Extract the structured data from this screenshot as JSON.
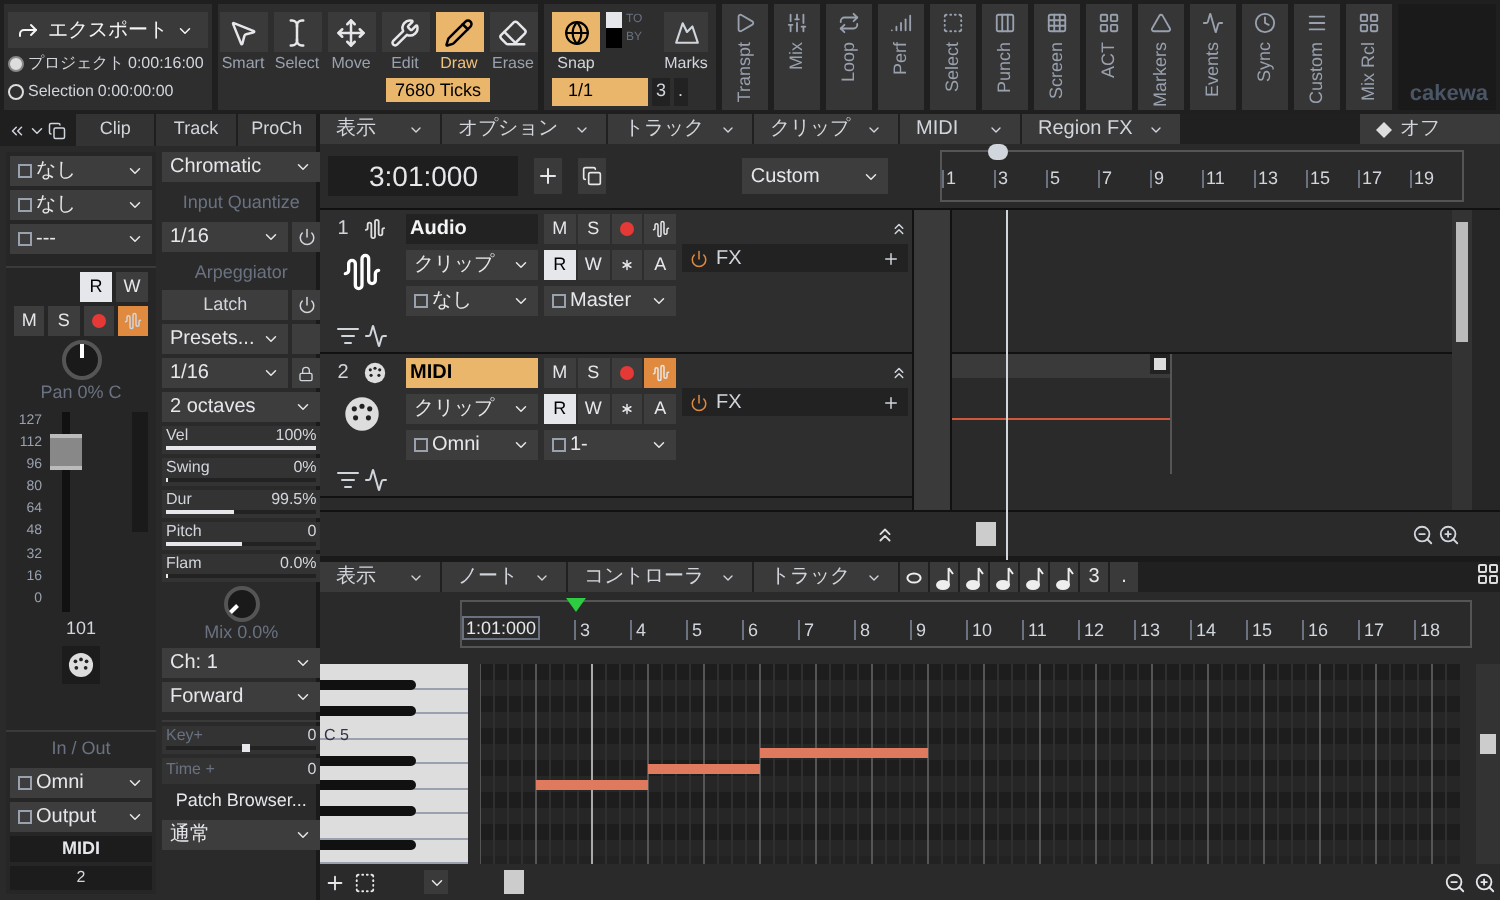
{
  "export": {
    "label": "エクスポート",
    "ranges": [
      {
        "label": "プロジェクト",
        "value": "0:00:16:00",
        "selected": true
      },
      {
        "label": "Selection",
        "value": "0:00:00:00",
        "selected": false
      }
    ]
  },
  "tools": [
    {
      "kind": "smart",
      "label": "Smart",
      "selected": false
    },
    {
      "kind": "select",
      "label": "Select",
      "selected": false
    },
    {
      "kind": "move",
      "label": "Move",
      "selected": false
    },
    {
      "kind": "edit",
      "label": "Edit",
      "selected": false
    },
    {
      "kind": "draw",
      "label": "Draw",
      "selected": true
    },
    {
      "kind": "erase",
      "label": "Erase",
      "selected": false
    }
  ],
  "tool_setting": "7680 Ticks",
  "snap": {
    "label": "Snap",
    "on": true,
    "to_label": "TO",
    "by_label": "BY",
    "resolution": "1/1",
    "value": "3",
    "dot": "."
  },
  "marks": {
    "label": "Marks"
  },
  "modules": [
    {
      "kind": "transport",
      "label": "Transpt"
    },
    {
      "kind": "mix",
      "label": "Mix"
    },
    {
      "kind": "loop",
      "label": "Loop"
    },
    {
      "kind": "perf",
      "label": "Perf"
    },
    {
      "kind": "select",
      "label": "Select"
    },
    {
      "kind": "punch",
      "label": "Punch"
    },
    {
      "kind": "screen",
      "label": "Screen"
    },
    {
      "kind": "act",
      "label": "ACT"
    },
    {
      "kind": "markers",
      "label": "Markers"
    },
    {
      "kind": "events",
      "label": "Events"
    },
    {
      "kind": "sync",
      "label": "Sync"
    },
    {
      "kind": "custom",
      "label": "Custom"
    },
    {
      "kind": "mixrecall",
      "label": "Mix Rcl"
    }
  ],
  "logo": "cakewa",
  "inspector": {
    "tabs": [
      {
        "label": "Clip",
        "selected": false
      },
      {
        "label": "Track",
        "selected": false
      },
      {
        "label": "ProCh",
        "selected": false
      }
    ],
    "strip": {
      "inputs": [
        {
          "label": "なし"
        },
        {
          "label": "なし"
        },
        {
          "label": "---"
        }
      ],
      "read": {
        "label": "R",
        "on": true
      },
      "write": {
        "label": "W",
        "on": false
      },
      "mute": {
        "label": "M",
        "on": false
      },
      "solo": {
        "label": "S",
        "on": false
      },
      "monitor_on": true,
      "pan": "Pan 0% C",
      "scale": [
        "127",
        "112",
        "96",
        "80",
        "64",
        "48",
        "32",
        "16",
        "0"
      ],
      "fader": {
        "level": 0.8,
        "value": "101"
      },
      "io_title": "In / Out",
      "io": [
        {
          "label": "Omni"
        },
        {
          "label": "Output"
        }
      ],
      "name": "MIDI",
      "number": "2"
    },
    "procs": {
      "scale": "Chromatic",
      "iq_title": "Input Quantize",
      "iq_value": "1/16",
      "iq_on": false,
      "arp_title": "Arpeggiator",
      "latch": "Latch",
      "arp_on": false,
      "presets": "Presets...",
      "rate": "1/16",
      "range": "2 octaves",
      "params": [
        {
          "label": "Vel",
          "value": "100%",
          "level": 1
        },
        {
          "label": "Swing",
          "value": "0%",
          "level": 0
        },
        {
          "label": "Dur",
          "value": "99.5%",
          "level": 0.45
        },
        {
          "label": "Pitch",
          "value": "0",
          "level": 0.5
        },
        {
          "label": "Flam",
          "value": "0.0%",
          "level": 0
        }
      ],
      "mix": "Mix 0.0%",
      "channel": "Ch: 1",
      "direction": "Forward",
      "key": {
        "label": "Key+",
        "value": "0",
        "level": 0.5
      },
      "time_label": "Time +",
      "time_value": "0",
      "patch_browser": "Patch Browser...",
      "mode": "通常"
    }
  },
  "track_view": {
    "menus": [
      "表示",
      "オプション",
      "トラック",
      "クリップ",
      "MIDI",
      "Region FX"
    ],
    "automation": "オフ",
    "time": "3:01:000",
    "preset": "Custom",
    "ruler": [
      "1",
      "3",
      "5",
      "7",
      "9",
      "11",
      "13",
      "15",
      "17",
      "19"
    ],
    "tracks": [
      {
        "kind": "audio",
        "number": "1",
        "name": "Audio",
        "selected": false,
        "monitor_on": false,
        "mute": "M",
        "solo": "S",
        "read": "R",
        "write": "W",
        "auto": "A",
        "fx": "FX",
        "clip_mode": "クリップ",
        "input": "なし",
        "output": "Master"
      },
      {
        "kind": "midi",
        "number": "2",
        "name": "MIDI",
        "selected": true,
        "monitor_on": true,
        "mute": "M",
        "solo": "S",
        "read": "R",
        "write": "W",
        "auto": "A",
        "fx": "FX",
        "clip_mode": "クリップ",
        "input": "Omni",
        "output": "1-"
      }
    ]
  },
  "piano_roll": {
    "menus": [
      "表示",
      "ノート",
      "コントローラ",
      "トラック"
    ],
    "tuplet": "3",
    "dot": ".",
    "time": "1:01:000",
    "ruler": [
      "3",
      "4",
      "5",
      "6",
      "7",
      "8",
      "9",
      "10",
      "11",
      "12",
      "13",
      "14",
      "15",
      "16",
      "17",
      "18"
    ],
    "key_label": "C 5"
  }
}
